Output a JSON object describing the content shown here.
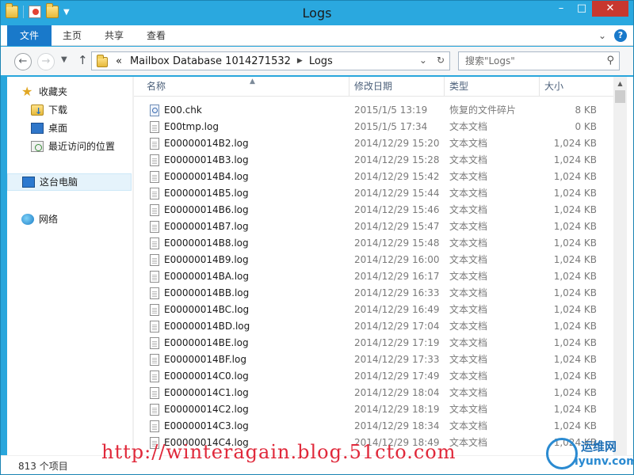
{
  "window": {
    "title": "Logs"
  },
  "ribbon": {
    "tabs": [
      "文件",
      "主页",
      "共享",
      "查看"
    ]
  },
  "address": {
    "overflow": "«",
    "crumbs": [
      "Mailbox Database 1014271532",
      "Logs"
    ]
  },
  "search": {
    "placeholder": "搜索\"Logs\""
  },
  "navpane": {
    "favorites_label": "收藏夹",
    "favorites": [
      "下载",
      "桌面",
      "最近访问的位置"
    ],
    "this_pc": "这台电脑",
    "network": "网络"
  },
  "columns": {
    "name": "名称",
    "date": "修改日期",
    "type": "类型",
    "size": "大小"
  },
  "files": [
    {
      "name": "E00.chk",
      "date": "2015/1/5 13:19",
      "type": "恢复的文件碎片",
      "size": "8 KB",
      "icon": "chk-file-icon"
    },
    {
      "name": "E00tmp.log",
      "date": "2015/1/5 17:34",
      "type": "文本文档",
      "size": "0 KB",
      "icon": "text-file-icon"
    },
    {
      "name": "E00000014B2.log",
      "date": "2014/12/29 15:20",
      "type": "文本文档",
      "size": "1,024 KB",
      "icon": "text-file-icon"
    },
    {
      "name": "E00000014B3.log",
      "date": "2014/12/29 15:28",
      "type": "文本文档",
      "size": "1,024 KB",
      "icon": "text-file-icon"
    },
    {
      "name": "E00000014B4.log",
      "date": "2014/12/29 15:42",
      "type": "文本文档",
      "size": "1,024 KB",
      "icon": "text-file-icon"
    },
    {
      "name": "E00000014B5.log",
      "date": "2014/12/29 15:44",
      "type": "文本文档",
      "size": "1,024 KB",
      "icon": "text-file-icon"
    },
    {
      "name": "E00000014B6.log",
      "date": "2014/12/29 15:46",
      "type": "文本文档",
      "size": "1,024 KB",
      "icon": "text-file-icon"
    },
    {
      "name": "E00000014B7.log",
      "date": "2014/12/29 15:47",
      "type": "文本文档",
      "size": "1,024 KB",
      "icon": "text-file-icon"
    },
    {
      "name": "E00000014B8.log",
      "date": "2014/12/29 15:48",
      "type": "文本文档",
      "size": "1,024 KB",
      "icon": "text-file-icon"
    },
    {
      "name": "E00000014B9.log",
      "date": "2014/12/29 16:00",
      "type": "文本文档",
      "size": "1,024 KB",
      "icon": "text-file-icon"
    },
    {
      "name": "E00000014BA.log",
      "date": "2014/12/29 16:17",
      "type": "文本文档",
      "size": "1,024 KB",
      "icon": "text-file-icon"
    },
    {
      "name": "E00000014BB.log",
      "date": "2014/12/29 16:33",
      "type": "文本文档",
      "size": "1,024 KB",
      "icon": "text-file-icon"
    },
    {
      "name": "E00000014BC.log",
      "date": "2014/12/29 16:49",
      "type": "文本文档",
      "size": "1,024 KB",
      "icon": "text-file-icon"
    },
    {
      "name": "E00000014BD.log",
      "date": "2014/12/29 17:04",
      "type": "文本文档",
      "size": "1,024 KB",
      "icon": "text-file-icon"
    },
    {
      "name": "E00000014BE.log",
      "date": "2014/12/29 17:19",
      "type": "文本文档",
      "size": "1,024 KB",
      "icon": "text-file-icon"
    },
    {
      "name": "E00000014BF.log",
      "date": "2014/12/29 17:33",
      "type": "文本文档",
      "size": "1,024 KB",
      "icon": "text-file-icon"
    },
    {
      "name": "E00000014C0.log",
      "date": "2014/12/29 17:49",
      "type": "文本文档",
      "size": "1,024 KB",
      "icon": "text-file-icon"
    },
    {
      "name": "E00000014C1.log",
      "date": "2014/12/29 18:04",
      "type": "文本文档",
      "size": "1,024 KB",
      "icon": "text-file-icon"
    },
    {
      "name": "E00000014C2.log",
      "date": "2014/12/29 18:19",
      "type": "文本文档",
      "size": "1,024 KB",
      "icon": "text-file-icon"
    },
    {
      "name": "E00000014C3.log",
      "date": "2014/12/29 18:34",
      "type": "文本文档",
      "size": "1,024 KB",
      "icon": "text-file-icon"
    },
    {
      "name": "E00000014C4.log",
      "date": "2014/12/29 18:49",
      "type": "文本文档",
      "size": "1,024 KB",
      "icon": "text-file-icon"
    }
  ],
  "status": {
    "item_count": "813 个项目"
  },
  "watermark": {
    "url": "http://winteragain.blog.51cto.com",
    "logo_cn": "运维网",
    "logo_en": "iyunv.com"
  },
  "colors": {
    "title_bar": "#2aa8df",
    "file_tab": "#1979ca",
    "close_button": "#c7372f",
    "watermark": "#e0283a"
  }
}
